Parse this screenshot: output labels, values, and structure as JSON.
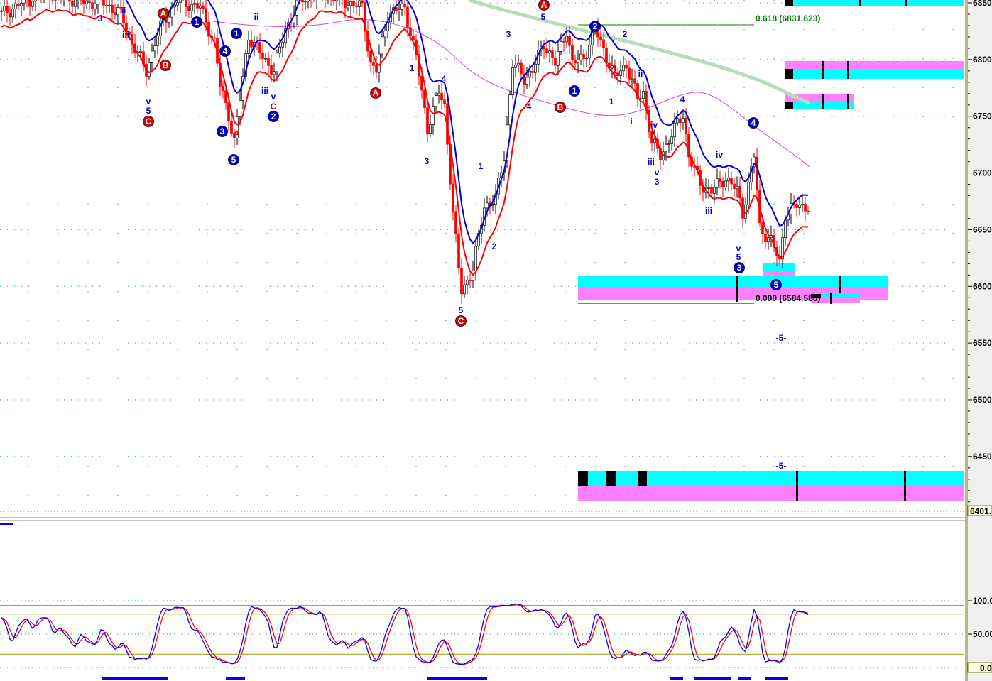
{
  "price_axis": {
    "ticks": [
      "6850",
      "6800",
      "6750",
      "6700",
      "6650",
      "6600",
      "6550",
      "6500",
      "6450"
    ],
    "last_value": "6401."
  },
  "osc_axis": {
    "ticks": [
      "100.0",
      "50.00"
    ],
    "last_value": "0.0"
  },
  "fib_labels": {
    "upper": "0.618 (6831.623)",
    "lower": "0.000 (6584.580)"
  },
  "colors": {
    "up": "#000000",
    "down": "#ff0000",
    "upper_band": "#0000dd",
    "lower_band": "#ff0000",
    "slow_ma": "#dd44dd",
    "trend_ma": "#b8dcb8",
    "cyan": "#00ffff",
    "magenta": "#ff80ff",
    "stoch_k": "#0000ff",
    "stoch_d": "#ff0000"
  },
  "wave_circles": [
    "A",
    "B",
    "C",
    "A",
    "C",
    "A",
    "B",
    "1",
    "4",
    "1",
    "3",
    "5",
    "2",
    "1",
    "2",
    "4",
    "3",
    "5"
  ],
  "wave_labels": [
    "3",
    "ii",
    "iii",
    "v",
    "5",
    "ii",
    "iii",
    "v",
    "1",
    "3",
    "4",
    "3",
    "5",
    "4",
    "1",
    "2",
    "5",
    "1",
    "2",
    "ii",
    "i",
    "iv",
    "iii",
    "v",
    "3",
    "4",
    "iii",
    "v",
    "5",
    "-5-",
    "-5-",
    "iv",
    "C",
    "A"
  ],
  "chart_data": {
    "type": "line",
    "title": "",
    "xlabel": "",
    "ylabel": "",
    "ylim": [
      6401,
      6852
    ],
    "osc_ylim": [
      0,
      100
    ],
    "osc_levels": [
      93,
      80,
      20
    ],
    "price_path": [
      [
        0,
        6840
      ],
      [
        15,
        6860
      ],
      [
        30,
        6850
      ],
      [
        35,
        6852
      ],
      [
        42,
        6840
      ],
      [
        46,
        6815
      ],
      [
        51,
        6790
      ],
      [
        54,
        6815
      ],
      [
        57,
        6834
      ],
      [
        62,
        6852
      ],
      [
        70,
        6846
      ],
      [
        75,
        6815
      ],
      [
        77,
        6777
      ],
      [
        80,
        6752
      ],
      [
        82,
        6727
      ],
      [
        85,
        6784
      ],
      [
        87,
        6821
      ],
      [
        92,
        6802
      ],
      [
        96,
        6790
      ],
      [
        100,
        6827
      ],
      [
        105,
        6852
      ],
      [
        112,
        6860
      ],
      [
        120,
        6852
      ],
      [
        127,
        6846
      ],
      [
        130,
        6796
      ],
      [
        132,
        6790
      ],
      [
        136,
        6840
      ],
      [
        142,
        6846
      ],
      [
        146,
        6802
      ],
      [
        150,
        6740
      ],
      [
        154,
        6771
      ],
      [
        156,
        6759
      ],
      [
        159,
        6665
      ],
      [
        161,
        6615
      ],
      [
        162,
        6596
      ],
      [
        166,
        6615
      ],
      [
        170,
        6671
      ],
      [
        174,
        6677
      ],
      [
        177,
        6715
      ],
      [
        180,
        6796
      ],
      [
        184,
        6784
      ],
      [
        187,
        6790
      ],
      [
        191,
        6815
      ],
      [
        195,
        6796
      ],
      [
        199,
        6827
      ],
      [
        201,
        6796
      ],
      [
        205,
        6802
      ],
      [
        209,
        6827
      ],
      [
        212,
        6809
      ],
      [
        216,
        6784
      ],
      [
        220,
        6796
      ],
      [
        224,
        6765
      ],
      [
        226,
        6771
      ],
      [
        229,
        6727
      ],
      [
        232,
        6715
      ],
      [
        236,
        6734
      ],
      [
        240,
        6752
      ],
      [
        242,
        6715
      ],
      [
        246,
        6690
      ],
      [
        250,
        6684
      ],
      [
        255,
        6696
      ],
      [
        259,
        6684
      ],
      [
        261,
        6665
      ],
      [
        265,
        6715
      ],
      [
        267,
        6652
      ],
      [
        271,
        6640
      ],
      [
        274,
        6621
      ],
      [
        276,
        6665
      ],
      [
        280,
        6671
      ],
      [
        284,
        6671
      ]
    ]
  }
}
